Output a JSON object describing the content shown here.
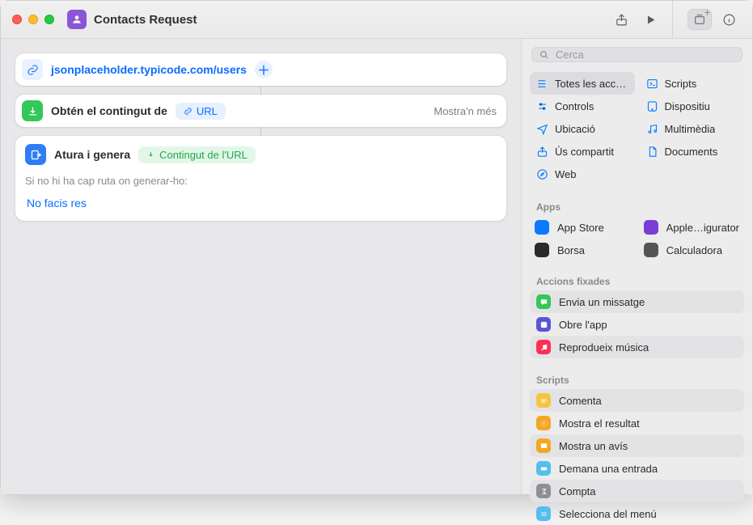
{
  "window": {
    "title": "Contacts Request"
  },
  "search": {
    "placeholder": "Cerca"
  },
  "workflow": {
    "url": {
      "value": "jsonplaceholder.typicode.com/users"
    },
    "getContents": {
      "title": "Obtén el contingut de",
      "token": "URL",
      "more": "Mostra'n més"
    },
    "stopOutput": {
      "title": "Atura i genera",
      "token": "Contingut de l'URL",
      "noDestLabel": "Si no hi ha cap ruta on generar-ho:",
      "doNothing": "No facis res"
    }
  },
  "categories": [
    {
      "name": "Totes les acci…",
      "icon": "list",
      "color": "#0a7aff",
      "selected": true
    },
    {
      "name": "Scripts",
      "icon": "terminal",
      "color": "#0a7aff",
      "selected": false
    },
    {
      "name": "Controls",
      "icon": "sliders",
      "color": "#0a7aff",
      "selected": false
    },
    {
      "name": "Dispositiu",
      "icon": "device",
      "color": "#0a7aff",
      "selected": false
    },
    {
      "name": "Ubicació",
      "icon": "location",
      "color": "#0a7aff",
      "selected": false
    },
    {
      "name": "Multimèdia",
      "icon": "music",
      "color": "#0a7aff",
      "selected": false
    },
    {
      "name": "Ús compartit",
      "icon": "share",
      "color": "#0a7aff",
      "selected": false
    },
    {
      "name": "Documents",
      "icon": "doc",
      "color": "#0a7aff",
      "selected": false
    },
    {
      "name": "Web",
      "icon": "safari",
      "color": "#0a7aff",
      "selected": false
    }
  ],
  "sections": {
    "apps": {
      "title": "Apps",
      "items": [
        {
          "name": "App Store",
          "color": "#0a7aff"
        },
        {
          "name": "Apple…igurator",
          "color": "#7a3ed6"
        },
        {
          "name": "Borsa",
          "color": "#2a2a2a"
        },
        {
          "name": "Calculadora",
          "color": "#555555"
        }
      ]
    },
    "pinned": {
      "title": "Accions fixades",
      "items": [
        {
          "name": "Envia un missatge",
          "color": "#34c759",
          "icon": "message"
        },
        {
          "name": "Obre l'app",
          "color": "#5856d6",
          "icon": "open"
        },
        {
          "name": "Reprodueix música",
          "color": "#ff2d55",
          "icon": "music"
        }
      ]
    },
    "scripts": {
      "title": "Scripts",
      "items": [
        {
          "name": "Comenta",
          "color": "#f5c542",
          "icon": "comment"
        },
        {
          "name": "Mostra el resultat",
          "color": "#f5a623",
          "icon": "eye"
        },
        {
          "name": "Mostra un avís",
          "color": "#f5a623",
          "icon": "alert"
        },
        {
          "name": "Demana una entrada",
          "color": "#55bef0",
          "icon": "input"
        },
        {
          "name": "Compta",
          "color": "#8e8e93",
          "icon": "sigma"
        },
        {
          "name": "Selecciona del menú",
          "color": "#55bef0",
          "icon": "menu"
        }
      ]
    }
  }
}
